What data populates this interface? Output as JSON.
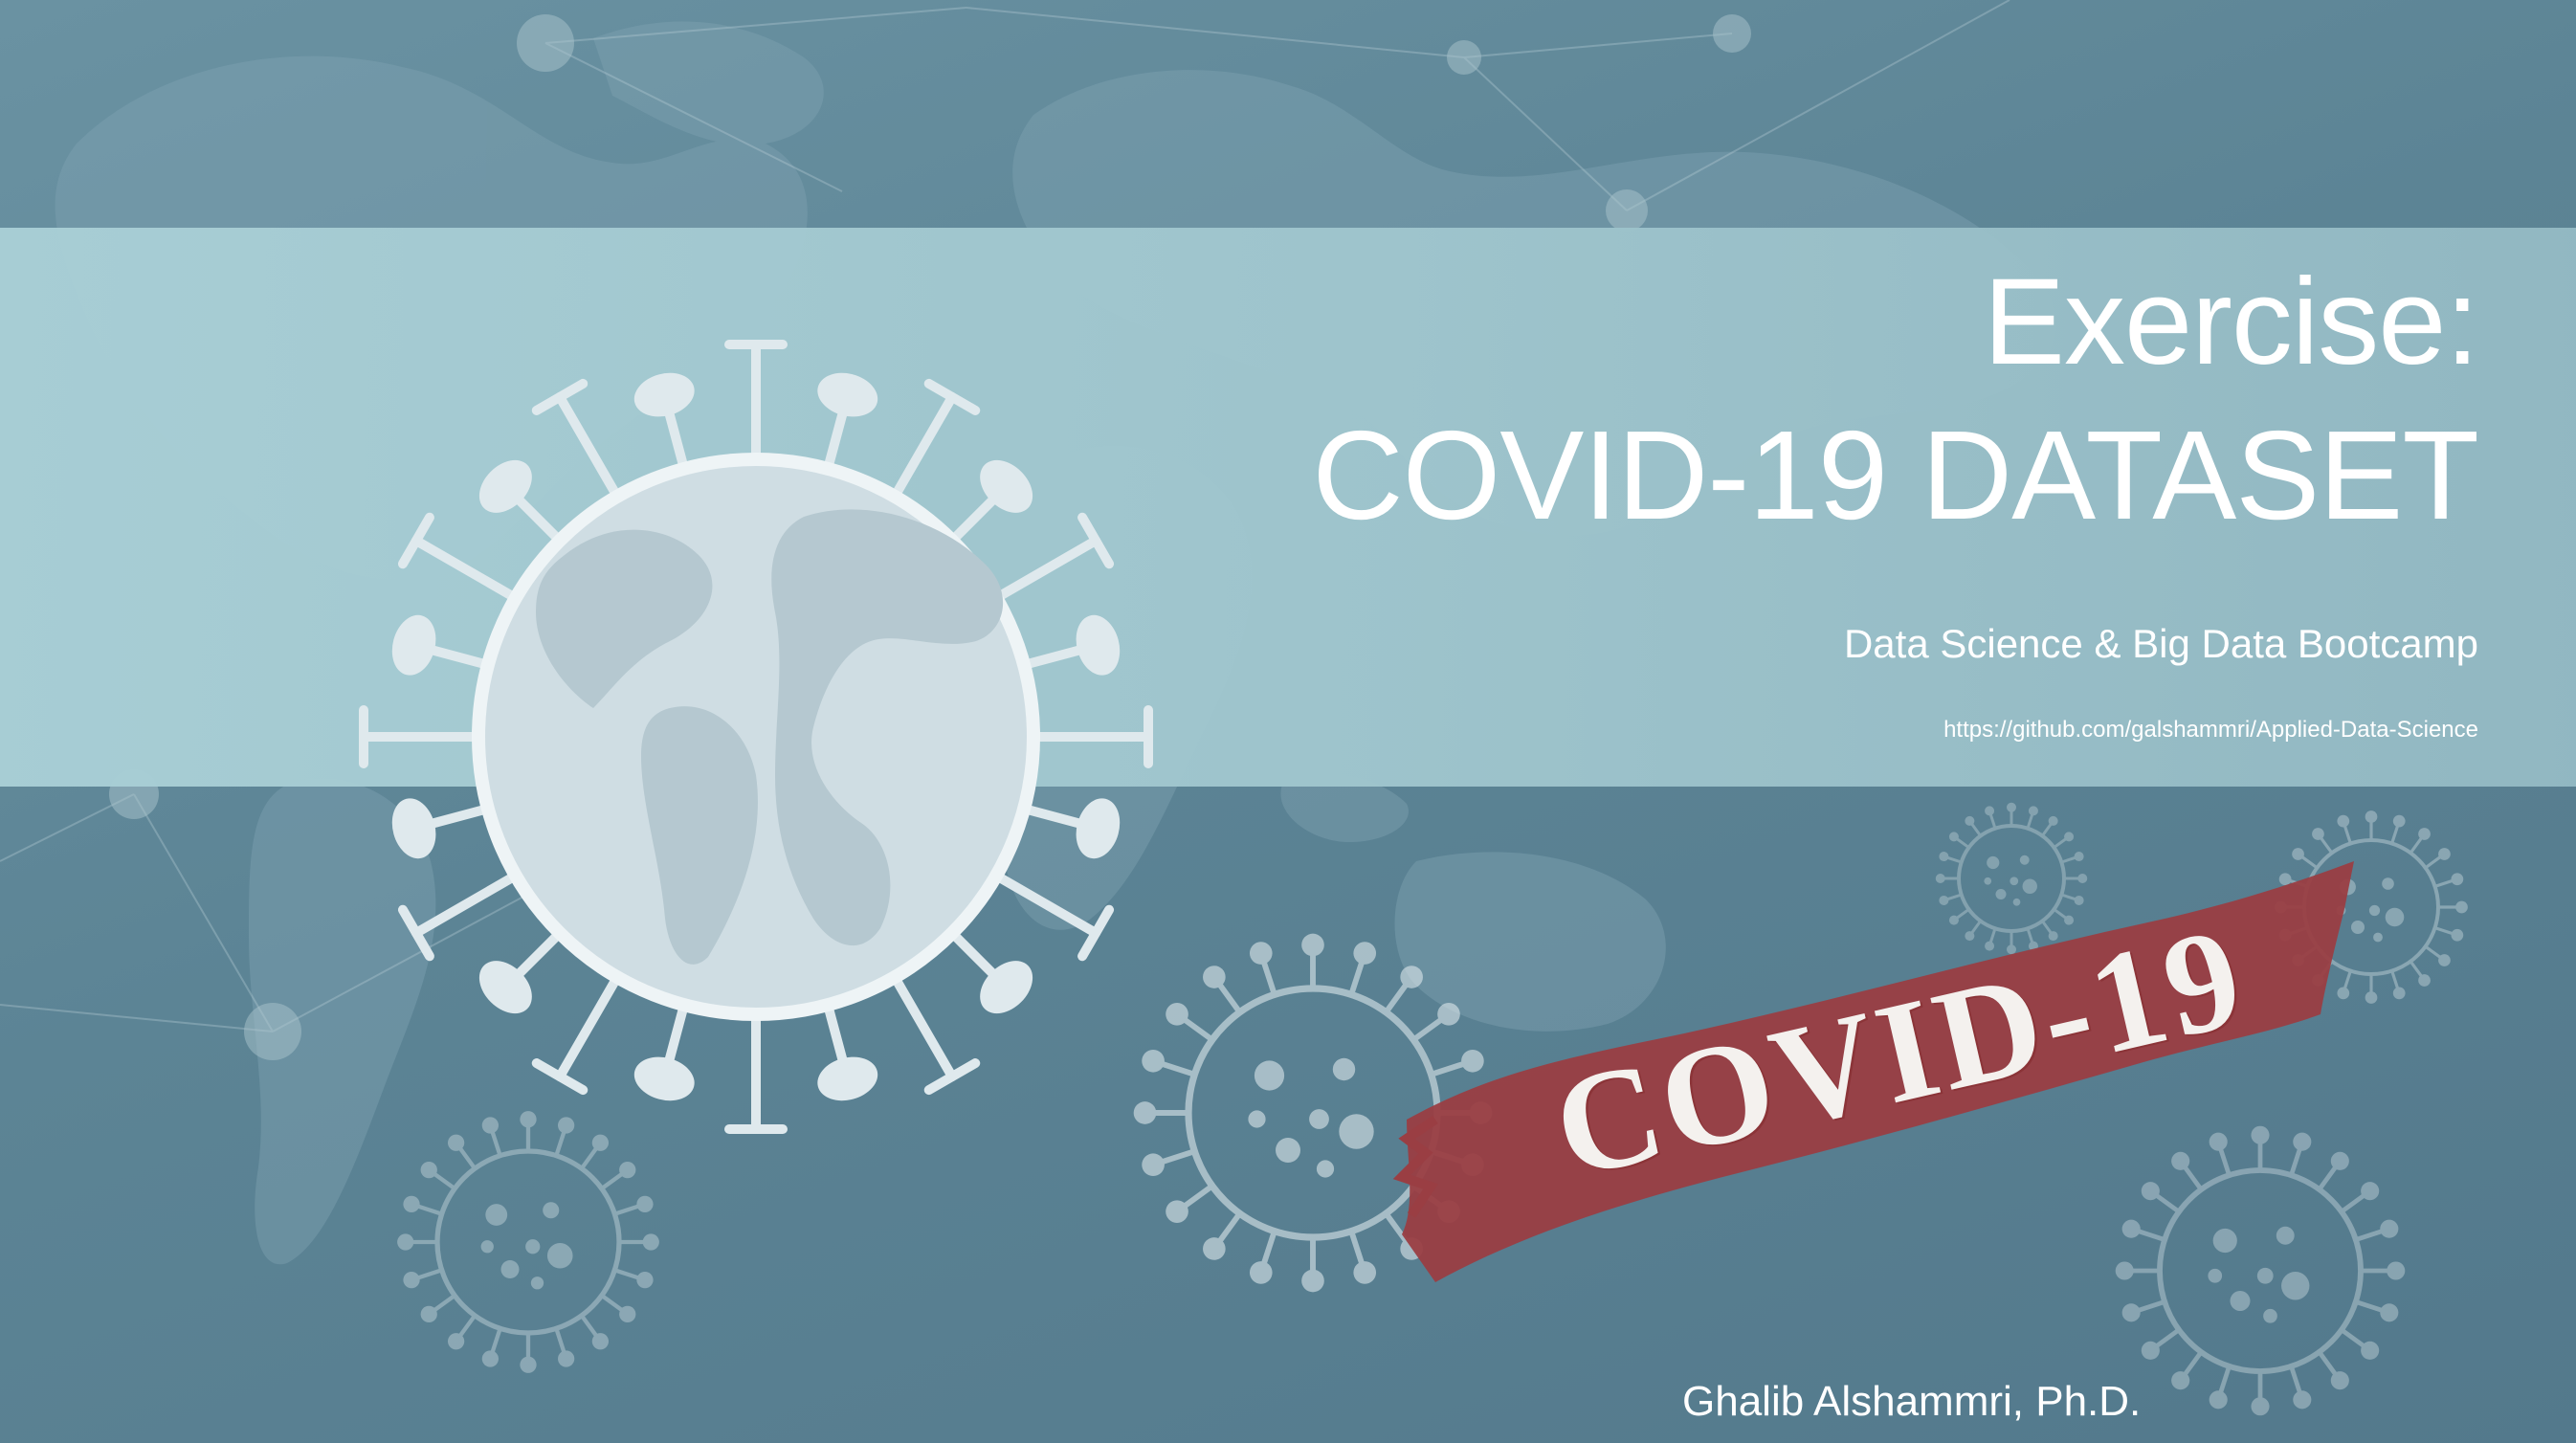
{
  "slide": {
    "title_line1": "Exercise:",
    "title_line2": "COVID-19 DATASET",
    "subtitle": "Data Science & Big Data Bootcamp",
    "url": "https://github.com/galshammri/Applied-Data-Science",
    "author": "Ghalib Alshammri, Ph.D.",
    "stamp_text": "COVID-19"
  },
  "colors": {
    "background": "#5e8596",
    "band": "#a9cfd6",
    "globe": "#dbe7eb",
    "virus_outline": "#eef4f6",
    "stamp": "#9a3e43",
    "text": "#ffffff"
  },
  "icons": [
    "world-map-background",
    "network-lines",
    "globe-virus-icon",
    "virus-icon",
    "covid-stamp"
  ]
}
